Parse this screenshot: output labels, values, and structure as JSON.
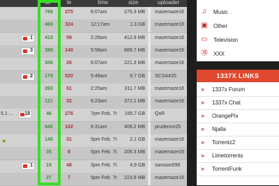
{
  "table": {
    "headers": {
      "se": "se",
      "le": "le",
      "time": "time",
      "size": "size",
      "uploader": "uploader"
    },
    "rows": [
      {
        "seeds": "766",
        "leeches": "275",
        "time": "6:07am",
        "size": "276.3 MB",
        "uploader": "mazemaze16",
        "comments": "",
        "prefix": ""
      },
      {
        "seeds": "466",
        "leeches": "324",
        "time": "12:17am",
        "size": "1.3 GB",
        "uploader": "mazemaze16",
        "comments": "",
        "prefix": ""
      },
      {
        "seeds": "410",
        "leeches": "59",
        "time": "2:28am",
        "size": "412.9 MB",
        "uploader": "mazemaze16",
        "comments": "1",
        "prefix": ""
      },
      {
        "seeds": "388",
        "leeches": "140",
        "time": "5:58am",
        "size": "889.7 MB",
        "uploader": "mazemaze16",
        "comments": "3",
        "prefix": ""
      },
      {
        "seeds": "306",
        "leeches": "26",
        "time": "6:07am",
        "size": "221.3 MB",
        "uploader": "mazemaze16",
        "comments": "",
        "prefix": ""
      },
      {
        "seeds": "178",
        "leeches": "520",
        "time": "5:48am",
        "size": "6.7 GB",
        "uploader": "SCSA420",
        "comments": "2",
        "prefix": ""
      },
      {
        "seeds": "265",
        "leeches": "51",
        "time": "2:25am",
        "size": "311.7 MB",
        "uploader": "mazemaze16",
        "comments": "",
        "prefix": ""
      },
      {
        "seeds": "121",
        "leeches": "32",
        "time": "6:23am",
        "size": "372.1 MB",
        "uploader": "mazemaze16",
        "comments": "",
        "prefix": ""
      },
      {
        "seeds": "46",
        "leeches": "276",
        "time": "7pm Feb. 7t",
        "size": "165.7 GB",
        "uploader": "QxR",
        "comments": "18",
        "prefix": "5.1 ..."
      },
      {
        "seeds": "640",
        "leeches": "102",
        "time": "6:31am",
        "size": "408.2 MB",
        "uploader": "prudence25",
        "comments": "",
        "prefix": ""
      },
      {
        "seeds": "146",
        "leeches": "31",
        "time": "5pm Feb. 7t",
        "size": "2.1 GB",
        "uploader": "mazemaze16",
        "comments": "",
        "prefix": ""
      },
      {
        "seeds": "35",
        "leeches": "8",
        "time": "5pm Feb. 7t",
        "size": "206.3 MB",
        "uploader": "mazemaze16",
        "comments": "",
        "prefix": ""
      },
      {
        "seeds": "19",
        "leeches": "48",
        "time": "3pm Feb. 7t",
        "size": "4.9 GB",
        "uploader": "samson599",
        "comments": "1",
        "prefix": ""
      },
      {
        "seeds": "27",
        "leeches": "7",
        "time": "5pm Feb. 7t",
        "size": "223.9 MB",
        "uploader": "mazemaze16",
        "comments": "",
        "prefix": ""
      }
    ]
  },
  "categories": [
    {
      "label": "Music",
      "icon": "music-icon",
      "glyph": "♫"
    },
    {
      "label": "Other",
      "icon": "other-icon",
      "glyph": "▣"
    },
    {
      "label": "Television",
      "icon": "television-icon",
      "glyph": "▭"
    },
    {
      "label": "XXX",
      "icon": "xxx-icon",
      "glyph": "⑱"
    }
  ],
  "links": {
    "title": "1337X LINKS",
    "items": [
      "1337x Forum",
      "1337x Chat",
      "OrangePix",
      "Njalla",
      "Torrentz2",
      "Limetorrents",
      "TorrentFunk"
    ]
  },
  "colors": {
    "highlight": "#35e022",
    "accent": "#e0492f",
    "seeds": "#3c8f3c",
    "leeches": "#a83232"
  }
}
